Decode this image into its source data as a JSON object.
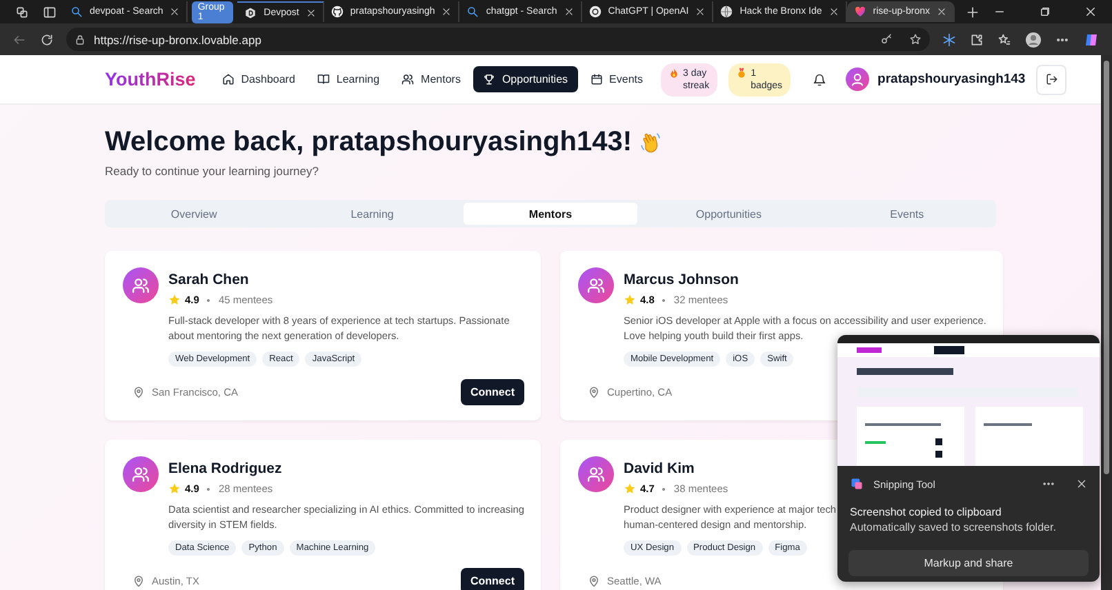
{
  "browser": {
    "tabs": [
      {
        "title": "devpoat - Search",
        "selected": false
      },
      {
        "title": "Devpost",
        "selected": false,
        "group": "Group 1"
      },
      {
        "title": "pratapshouryasingh",
        "selected": false
      },
      {
        "title": "chatgpt - Search",
        "selected": false
      },
      {
        "title": "ChatGPT | OpenAI",
        "selected": false
      },
      {
        "title": "Hack the Bronx Ide",
        "selected": false
      },
      {
        "title": "rise-up-bronx",
        "selected": true
      }
    ],
    "address": "https://rise-up-bronx.lovable.app"
  },
  "nav": {
    "logo": "YouthRise",
    "items": [
      {
        "label": "Dashboard",
        "selected": false
      },
      {
        "label": "Learning",
        "selected": false
      },
      {
        "label": "Mentors",
        "selected": false
      },
      {
        "label": "Opportunities",
        "selected": true
      },
      {
        "label": "Events",
        "selected": false
      }
    ],
    "badges": [
      {
        "kind": "streak",
        "label": "3 day streak"
      },
      {
        "kind": "badges",
        "label": "1 badges"
      }
    ],
    "username": "pratapshouryasingh143"
  },
  "welcome": {
    "title": "Welcome back, pratapshouryasingh143!",
    "subtitle": "Ready to continue your learning journey?"
  },
  "tabs": [
    {
      "label": "Overview",
      "selected": false
    },
    {
      "label": "Learning",
      "selected": false
    },
    {
      "label": "Mentors",
      "selected": true
    },
    {
      "label": "Opportunities",
      "selected": false
    },
    {
      "label": "Events",
      "selected": false
    }
  ],
  "mentors": [
    {
      "name": "Sarah Chen",
      "rating": "4.9",
      "mentees": "45 mentees",
      "description_lines": [
        "Full-stack developer with 8 years of experience at tech startups. Passionate",
        "about mentoring the next generation of developers."
      ],
      "tags": [
        "Web Development",
        "React",
        "JavaScript"
      ],
      "location": "San Francisco, CA",
      "action": "Connect"
    },
    {
      "name": "Marcus Johnson",
      "rating": "4.8",
      "mentees": "32 mentees",
      "description_lines": [
        "Senior iOS developer at Apple with a focus on accessibility and user experience.",
        "Love helping youth build their first apps."
      ],
      "tags": [
        "Mobile Development",
        "iOS",
        "Swift"
      ],
      "location": "Cupertino, CA"
    },
    {
      "name": "Elena Rodriguez",
      "rating": "4.9",
      "mentees": "28 mentees",
      "description_lines": [
        "Data scientist and researcher specializing in AI ethics. Committed to increasing",
        "diversity in STEM fields."
      ],
      "tags": [
        "Data Science",
        "Python",
        "Machine Learning"
      ],
      "location": "Austin, TX",
      "action": "Connect"
    },
    {
      "name": "David Kim",
      "rating": "4.7",
      "mentees": "38 mentees",
      "description_lines": [
        "Product designer with experience at major tech",
        "human-centered design and mentorship."
      ],
      "tags": [
        "UX Design",
        "Product Design",
        "Figma"
      ],
      "location": "Seattle, WA"
    }
  ],
  "toast": {
    "app": "Snipping Tool",
    "title": "Screenshot copied to clipboard",
    "message": "Automatically saved to screenshots folder.",
    "action": "Markup and share"
  }
}
